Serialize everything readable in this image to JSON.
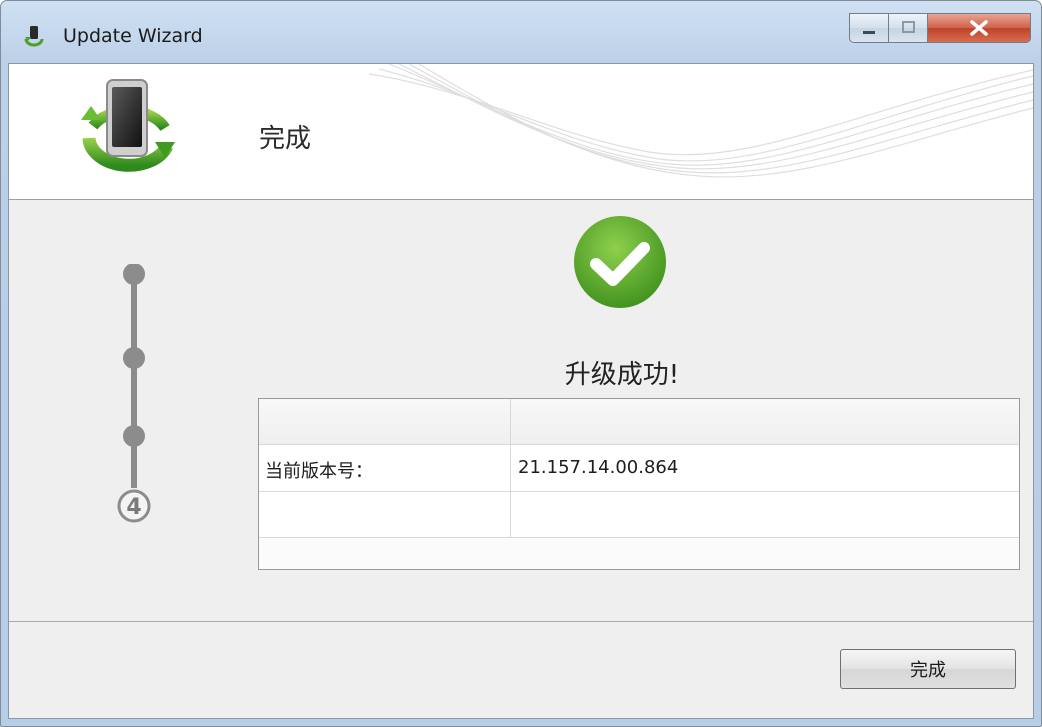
{
  "window": {
    "title": "Update Wizard"
  },
  "banner": {
    "title": "完成"
  },
  "steps": {
    "current_step": "4",
    "total_steps": 4
  },
  "result": {
    "message": "升级成功!"
  },
  "info_table": {
    "rows": [
      {
        "label": "",
        "value": ""
      },
      {
        "label": "当前版本号：",
        "value": "21.157.14.00.864"
      },
      {
        "label": "",
        "value": ""
      }
    ]
  },
  "footer": {
    "finish_label": "完成"
  },
  "colors": {
    "success_green": "#5aa82e",
    "step_gray": "#8c8c8c",
    "banner_bg": "#ffffff",
    "client_bg": "#efefef"
  }
}
